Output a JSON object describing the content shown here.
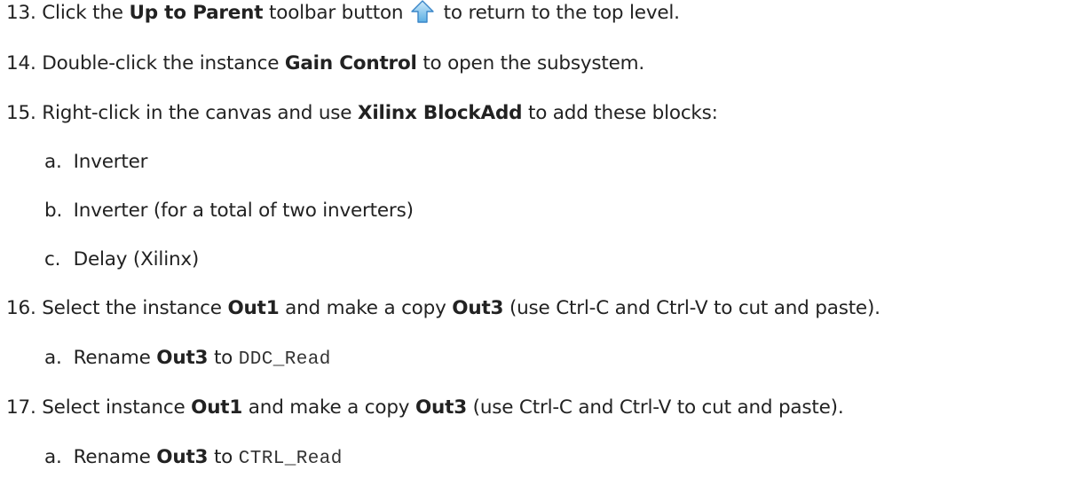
{
  "steps": {
    "s13": {
      "num": "13.",
      "pre": "Click the",
      "bold": "Up to Parent",
      "mid": "toolbar button",
      "icon": "up-arrow-icon",
      "post": "to return to the top level."
    },
    "s14": {
      "num": "14.",
      "pre": "Double-click the instance",
      "bold": "Gain Control",
      "post": "to open the subsystem."
    },
    "s15": {
      "num": "15.",
      "pre": "Right-click in the canvas and use",
      "bold": "Xilinx BlockAdd",
      "post": "to add these blocks:",
      "items": [
        {
          "letter": "a.",
          "text": "Inverter"
        },
        {
          "letter": "b.",
          "text": "Inverter (for a total of two inverters)"
        },
        {
          "letter": "c.",
          "text": "Delay (Xilinx)"
        }
      ]
    },
    "s16": {
      "num": "16.",
      "pre": "Select the instance",
      "bold1": "Out1",
      "mid": "and make a copy",
      "bold2": "Out3",
      "post": "(use Ctrl-C and Ctrl-V to cut and paste).",
      "sub": {
        "letter": "a.",
        "pre": "Rename",
        "bold": "Out3",
        "mid": "to",
        "code": "DDC_Read"
      }
    },
    "s17": {
      "num": "17.",
      "pre": "Select instance",
      "bold1": "Out1",
      "mid": "and make a copy",
      "bold2": "Out3",
      "post": "(use Ctrl-C and Ctrl-V to cut and paste).",
      "sub": {
        "letter": "a.",
        "pre": "Rename",
        "bold": "Out3",
        "mid": "to",
        "code": "CTRL_Read"
      }
    }
  },
  "colors": {
    "text": "#222222",
    "icon_fill": "#7ec3ea",
    "icon_stroke": "#3a86c8"
  }
}
